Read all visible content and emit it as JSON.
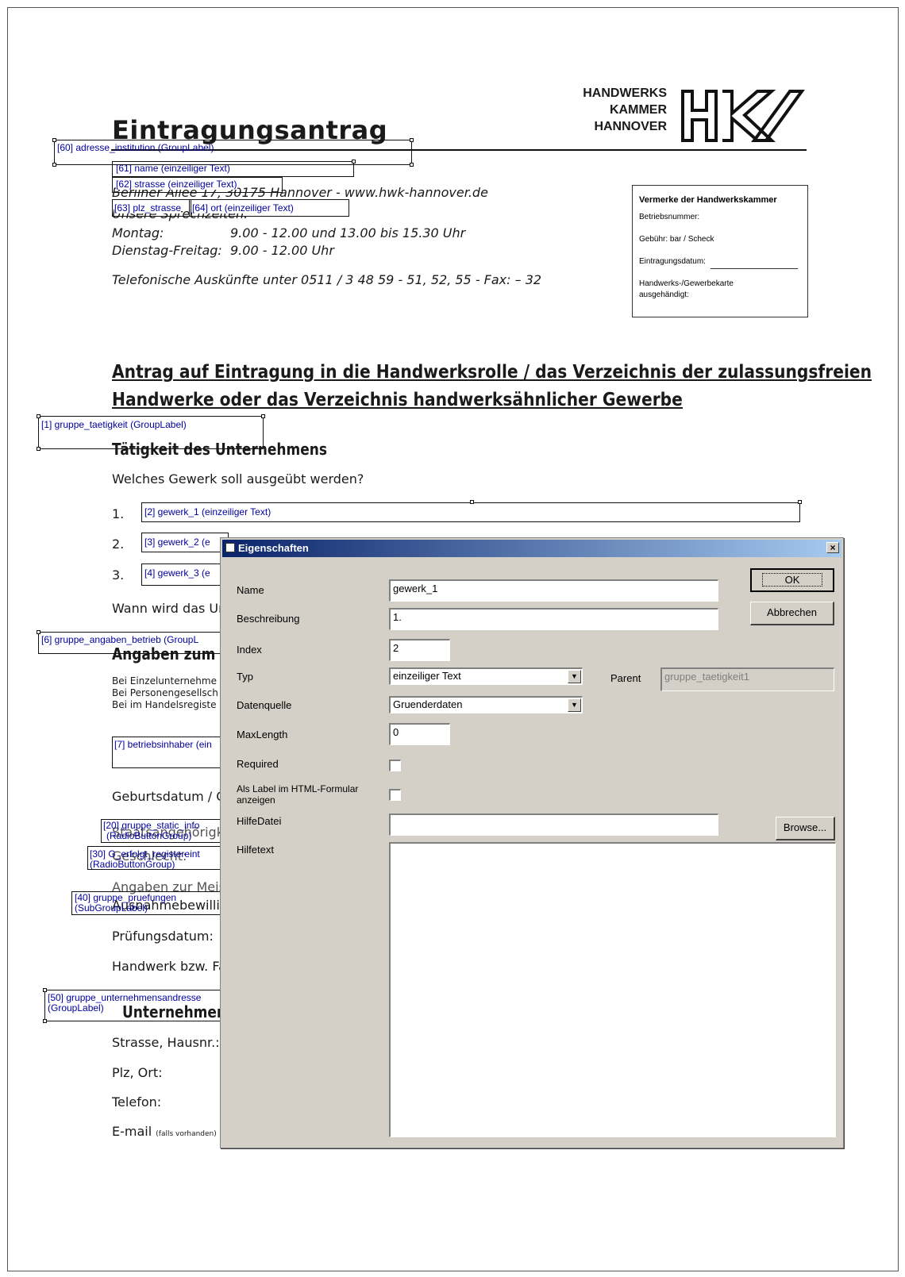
{
  "logo": {
    "line1": "HANDWERKS",
    "line2": "KAMMER",
    "line3": "HANNOVER",
    "mark": "HK"
  },
  "doc": {
    "title": "Eintragungsantrag",
    "address_line": "Berliner Allee 17, 30175 Hannover - www.hwk-hannover.de",
    "hours_heading": "Unsere Sprechzeiten:",
    "hours": [
      {
        "day": "Montag:",
        "time": "9.00 - 12.00 und 13.00 bis 15.30 Uhr"
      },
      {
        "day": "Dienstag-Freitag:",
        "time": "9.00 - 12.00 Uhr"
      }
    ],
    "phone_line": "Telefonische Auskünfte unter 0511 / 3 48 59 - 51, 52, 55 - Fax: – 32",
    "heading_line1": "Antrag auf Eintragung in die Handwerksrolle / das Verzeichnis der zulassungsfreien",
    "heading_line2": "Handwerke oder das Verzeichnis handwerksähnlicher Gewerbe",
    "section1": "Tätigkeit des Unternehmens",
    "question1": "Welches Gewerk soll ausgeübt werden?",
    "num1": "1.",
    "num2": "2.",
    "num3": "3.",
    "question2": "Wann wird das Ur",
    "section2": "Angaben zum E",
    "small1": "Bei Einzelunternehme",
    "small2": "Bei Personengesellsch",
    "small3": "Bei im Handelsregiste",
    "geburtsdatum": "Geburtsdatum / G",
    "staatsang": "Staatsangehörigke",
    "geschlecht": "Geschlecht:",
    "angaben_meister": "Angaben zur Meis",
    "ausnahme": "Ausnahmebewillig",
    "pruefungsdatum": "Prüfungsdatum:",
    "handwerk": "Handwerk bzw. Fa",
    "section3": "Unternehmensa",
    "strasse": "Strasse, Hausnr.:",
    "plz": "Plz, Ort:",
    "telefon": "Telefon:",
    "email": "E-mail",
    "email_note": "(falls vorhanden)"
  },
  "vermerke": {
    "title": "Vermerke der Handwerkskammer",
    "line1": "Betriebsnummer:",
    "line2": "Gebühr:  bar  /  Scheck",
    "line3": "Eintragungsdatum:",
    "line4": "Handwerks-/Gewerbekarte",
    "line5": "ausgehändigt:"
  },
  "overlays": {
    "o60": "[60] adresse_institution (GroupLabel)",
    "o61": "[61] name (einzeiliger Text)",
    "o62": "[62] strasse (einzeiliger Text)",
    "o63": "[63] plz_strasse",
    "o64": "[64] ort (einzeiliger Text)",
    "o1": "[1] gruppe_taetigkeit (GroupLabel)",
    "o2": "[2] gewerk_1 (einzeiliger Text)",
    "o3": "[3] gewerk_2 (e",
    "o4": "[4] gewerk_3 (e",
    "o6": "[6] gruppe_angaben_betrieb (GroupL",
    "o7": "[7] betriebsinhaber (ein",
    "o20a": "[20] gruppe_static_info",
    "o20b": "(RadioButtonGroup)",
    "o30a": "[30] G_erfolgt_registereint",
    "o30b": "(RadioButtonGroup)",
    "o40a": "[40] gruppe_pruefungen",
    "o40b": "(SubGroupLabel)",
    "o50a": "[50] gruppe_unternehmensandresse",
    "o50b": "(GroupLabel)"
  },
  "dialog": {
    "title": "Eigenschaften",
    "close": "×",
    "ok": "OK",
    "cancel": "Abbrechen",
    "browse": "Browse...",
    "labels": {
      "name": "Name",
      "beschreibung": "Beschreibung",
      "index": "Index",
      "typ": "Typ",
      "datenquelle": "Datenquelle",
      "maxlength": "MaxLength",
      "required": "Required",
      "als_label1": "Als Label im HTML-Formular",
      "als_label2": "anzeigen",
      "hilfedatei": "HilfeDatei",
      "hilfetext": "Hilfetext",
      "parent": "Parent"
    },
    "values": {
      "name": "gewerk_1",
      "beschreibung": "1.",
      "index": "2",
      "typ": "einzeiliger Text",
      "datenquelle": "Gruenderdaten",
      "maxlength": "0",
      "parent": "gruppe_taetigkeit1",
      "hilfedatei": "",
      "hilfetext": "",
      "required": false,
      "als_label": false
    }
  }
}
